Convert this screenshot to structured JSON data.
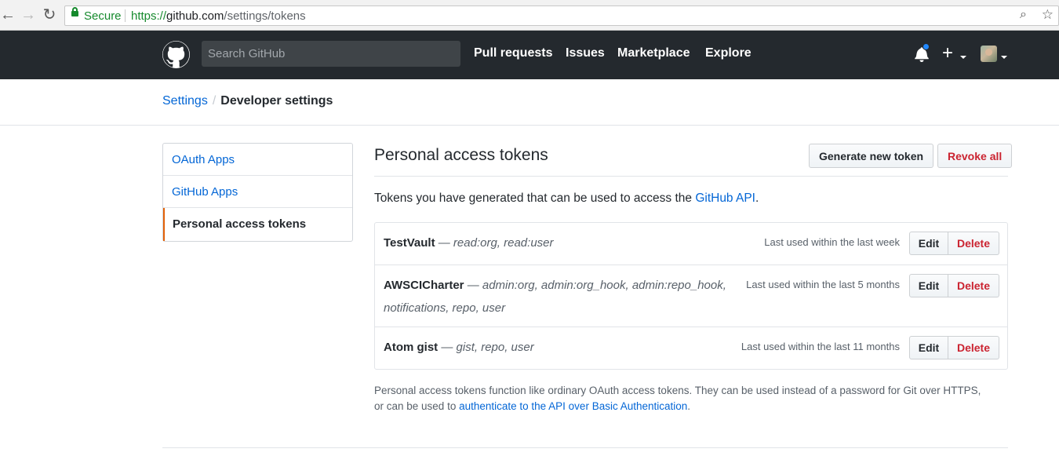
{
  "browser": {
    "secure_label": "Secure",
    "url_scheme": "https://",
    "url_host": "github.com",
    "url_path": "/settings/tokens"
  },
  "header": {
    "search_placeholder": "Search GitHub",
    "nav": [
      "Pull requests",
      "Issues",
      "Marketplace",
      "Explore"
    ],
    "plus": "+"
  },
  "breadcrumb": {
    "parent": "Settings",
    "separator": "/",
    "current": "Developer settings"
  },
  "sidebar": {
    "items": [
      {
        "label": "OAuth Apps"
      },
      {
        "label": "GitHub Apps"
      },
      {
        "label": "Personal access tokens"
      }
    ]
  },
  "main": {
    "title": "Personal access tokens",
    "generate_label": "Generate new token",
    "revoke_label": "Revoke all",
    "intro_before": "Tokens you have generated that can be used to access the ",
    "intro_link": "GitHub API",
    "intro_after": "."
  },
  "tokens": [
    {
      "name": "TestVault",
      "dash": " — ",
      "scopes_line1": "read:org, read:user",
      "scopes_line2": "",
      "last_used": "Last used within the last week",
      "edit": "Edit",
      "delete": "Delete"
    },
    {
      "name": "AWSCICharter",
      "dash": " — ",
      "scopes_line1": "admin:org, admin:org_hook, admin:repo_hook,",
      "scopes_line2": "notifications, repo, user",
      "last_used": "Last used within the last 5 months",
      "edit": "Edit",
      "delete": "Delete"
    },
    {
      "name": "Atom gist",
      "dash": " — ",
      "scopes_line1": "gist, repo, user",
      "scopes_line2": "",
      "last_used": "Last used within the last 11 months",
      "edit": "Edit",
      "delete": "Delete"
    }
  ],
  "note": {
    "text_before": "Personal access tokens function like ordinary OAuth access tokens. They can be used instead of a password for Git over HTTPS,",
    "text_line2": "or can be used to ",
    "link": "authenticate to the API over Basic Authentication",
    "text_after": "."
  },
  "colors": {
    "header_bg": "#24292e",
    "link": "#0366d6",
    "danger": "#cb2431",
    "selected_accent": "#e36209",
    "notification_dot": "#2188ff"
  }
}
